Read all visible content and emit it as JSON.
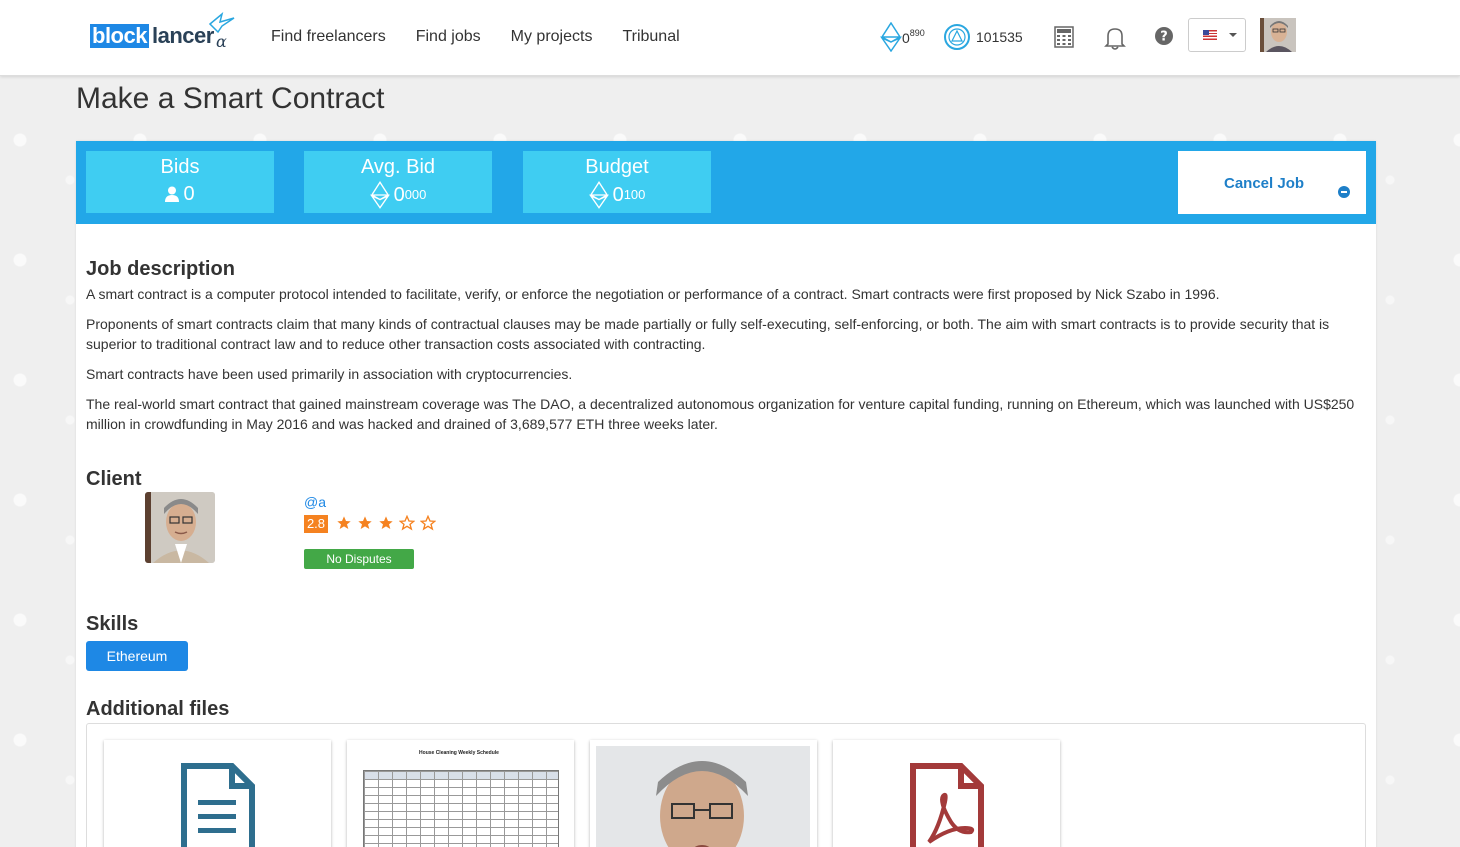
{
  "navbar": {
    "logo_block": "block",
    "logo_lancer": "lancer",
    "logo_alpha": "α",
    "links": [
      "Find freelancers",
      "Find jobs",
      "My projects",
      "Tribunal"
    ],
    "eth_balance": "0",
    "eth_balance_decimals": "890",
    "token_balance": "101535",
    "language_flag": "us-flag-icon"
  },
  "page": {
    "title": "Make a Smart Contract"
  },
  "stats": {
    "bids_label": "Bids",
    "bids_value": "0",
    "avg_label": "Avg. Bid",
    "avg_value": "0",
    "avg_decimals": "000",
    "budget_label": "Budget",
    "budget_value": "0",
    "budget_decimals": "100",
    "cancel_label": "Cancel Job"
  },
  "job_description": {
    "heading": "Job description",
    "paragraphs": [
      "A smart contract is a computer protocol intended to facilitate, verify, or enforce the negotiation or performance of a contract. Smart contracts were first proposed by Nick Szabo in 1996.",
      "Proponents of smart contracts claim that many kinds of contractual clauses may be made partially or fully self-executing, self-enforcing, or both. The aim with smart contracts is to provide security that is superior to traditional contract law and to reduce other transaction costs associated with contracting.",
      "Smart contracts have been used primarily in association with cryptocurrencies.",
      "The real-world smart contract that gained mainstream coverage was The DAO, a decentralized autonomous organization for venture capital funding, running on Ethereum, which was launched with US$250 million in crowdfunding in May 2016 and was hacked and drained of 3,689,577 ETH three weeks later."
    ]
  },
  "client": {
    "heading": "Client",
    "username": "@a",
    "rating": "2.8",
    "stars_filled": 3,
    "stars_total": 5,
    "dispute_badge": "No Disputes"
  },
  "skills": {
    "heading": "Skills",
    "items": [
      "Ethereum"
    ]
  },
  "files": {
    "heading": "Additional files",
    "items": [
      {
        "type": "document",
        "icon": "document-icon"
      },
      {
        "type": "spreadsheet",
        "preview_title": "House Cleaning Weekly Schedule"
      },
      {
        "type": "image",
        "icon": "photo-thumbnail"
      },
      {
        "type": "pdf",
        "icon": "pdf-icon"
      }
    ]
  },
  "colors": {
    "primary": "#1e88e5",
    "stats_bar": "#22a7e8",
    "stat_box": "#3fcdf2",
    "rating_orange": "#f58220",
    "dispute_green": "#43a847",
    "doc_icon": "#2e6e8e",
    "pdf_icon": "#a33a3a"
  }
}
